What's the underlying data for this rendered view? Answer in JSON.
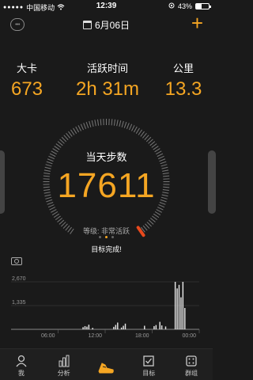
{
  "status_bar": {
    "carrier": "中国移动",
    "time": "12:39",
    "battery": "43%",
    "battery_level": 0.43
  },
  "header": {
    "date": "6月06日",
    "plus": "+"
  },
  "stats": [
    {
      "label": "大卡",
      "value": "673"
    },
    {
      "label": "活跃时间",
      "value": "2h 31m"
    },
    {
      "label": "公里",
      "value": "13.3"
    }
  ],
  "dial": {
    "title": "当天步数",
    "steps": "17611",
    "level": "等级: 非常活跃",
    "progress": 1.0
  },
  "goal_text": "目标完成!",
  "pager": {
    "count": 3,
    "active": 1
  },
  "chart_data": {
    "type": "bar",
    "yticks": [
      "2,670",
      "1,335"
    ],
    "xticks": [
      "06:00",
      "12:00",
      "18:00",
      "00:00"
    ],
    "ylim": [
      0,
      2670
    ],
    "bins": 96,
    "values": [
      0,
      0,
      0,
      0,
      0,
      0,
      0,
      0,
      0,
      0,
      0,
      0,
      0,
      0,
      0,
      0,
      0,
      0,
      0,
      0,
      0,
      0,
      0,
      0,
      0,
      0,
      0,
      0,
      0,
      0,
      0,
      0,
      0,
      0,
      0,
      0,
      0,
      120,
      180,
      150,
      260,
      0,
      80,
      0,
      0,
      0,
      0,
      0,
      0,
      0,
      0,
      0,
      0,
      140,
      250,
      380,
      0,
      100,
      200,
      320,
      0,
      0,
      0,
      0,
      0,
      0,
      0,
      0,
      0,
      200,
      0,
      0,
      0,
      0,
      180,
      240,
      0,
      420,
      220,
      0,
      160,
      0,
      0,
      0,
      0,
      2670,
      2300,
      2500,
      1800,
      2670,
      1200,
      0,
      0,
      0,
      0,
      0,
      0,
      0
    ]
  },
  "tabbar": [
    {
      "label": "我"
    },
    {
      "label": "分析"
    },
    {
      "label": ""
    },
    {
      "label": "目标"
    },
    {
      "label": "群组"
    }
  ]
}
